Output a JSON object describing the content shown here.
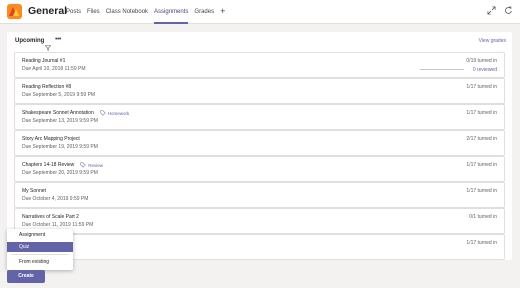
{
  "header": {
    "channel_name": "General",
    "tabs": [
      {
        "label": "Posts",
        "active": false
      },
      {
        "label": "Files",
        "active": false
      },
      {
        "label": "Class Notebook",
        "active": false
      },
      {
        "label": "Assignments",
        "active": true
      },
      {
        "label": "Grades",
        "active": false
      }
    ],
    "add_tab_icon": "plus-icon",
    "right_icons": [
      "expand-icon",
      "refresh-icon"
    ]
  },
  "colors": {
    "accent": "#6264a7",
    "accent_dark": "#464775",
    "page_bg": "#f3f2f1",
    "team_avatar_bg": "#fb8b1e"
  },
  "list": {
    "heading": "Upcoming",
    "view_grades": "View grades",
    "assignments": [
      {
        "title": "Reading Journal #1",
        "due": "Due April 10, 2018 11:59 PM",
        "turned_in": "0/19 turned in",
        "reviewed": "0 reviewed",
        "progress": 0
      },
      {
        "title": "Reading Reflection #8",
        "due": "Due September 5, 2019 9:59 PM",
        "turned_in": "1/17 turned in"
      },
      {
        "title": "Shakespeare Sonnet Annotation",
        "due": "Due September 13, 2019 9:59 PM",
        "turned_in": "1/17 turned in",
        "tag": "Homework",
        "tag_icon": "tag-icon"
      },
      {
        "title": "Story Arc Mapping Project",
        "due": "Due September 19, 2019 9:59 PM",
        "turned_in": "2/17 turned in"
      },
      {
        "title": "Chapters 14-18 Review",
        "due": "Due September 20, 2019 9:59 PM",
        "turned_in": "1/17 turned in",
        "tag": "Review",
        "tag_icon": "tag-icon"
      },
      {
        "title": "My Sonnet",
        "due": "Due October 4, 2019 9:59 PM",
        "turned_in": "1/17 turned in"
      },
      {
        "title": "Narratives of Scale Part 2",
        "due": "Due October 11, 2019 11:59 PM",
        "turned_in": "0/1 turned in"
      },
      {
        "title": "",
        "due": "",
        "turned_in": "1/17 turned in"
      }
    ]
  },
  "create_menu": {
    "items": [
      {
        "label": "Assignment",
        "selected": false
      },
      {
        "label": "Quiz",
        "selected": true
      },
      {
        "label": "From existing",
        "selected": false
      }
    ],
    "create_button": "Create"
  }
}
